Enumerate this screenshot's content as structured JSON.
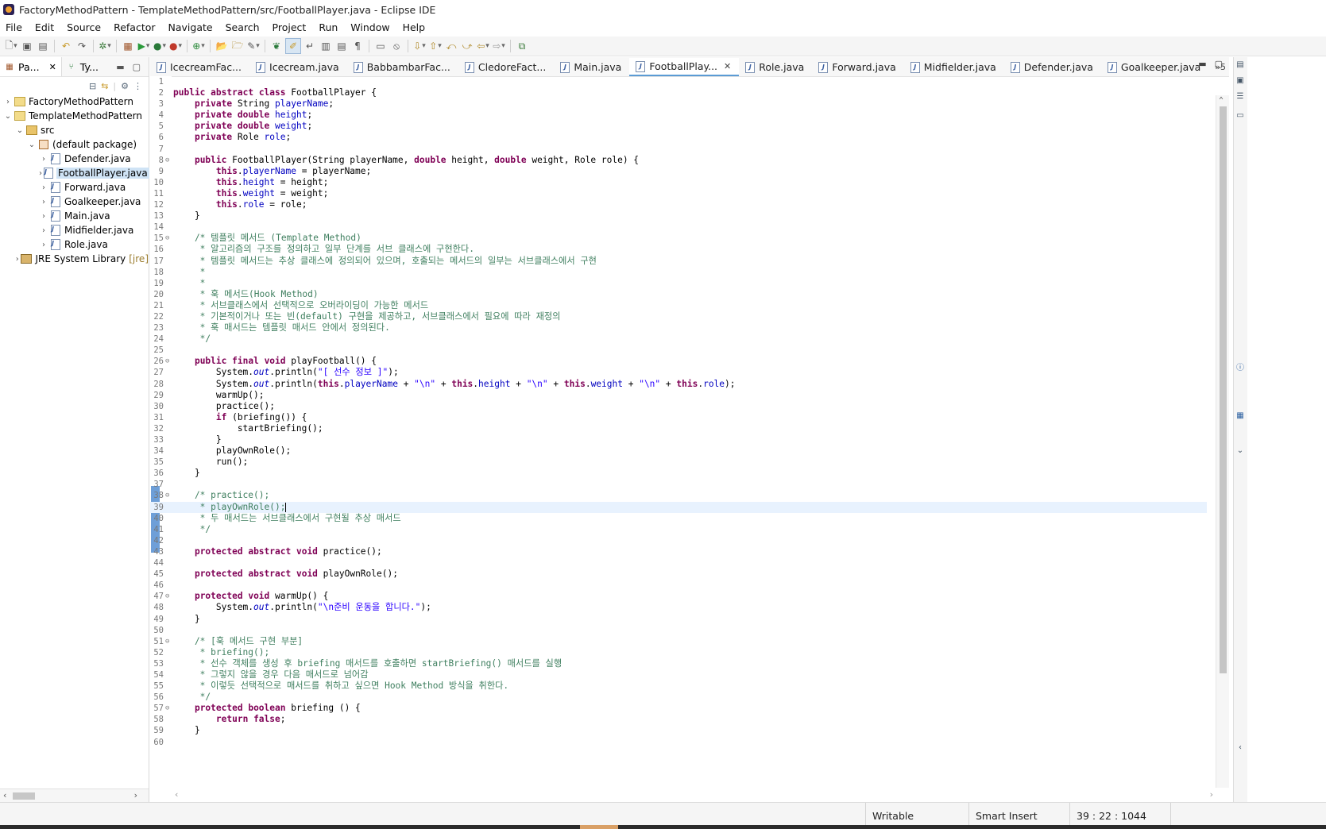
{
  "window": {
    "title": "FactoryMethodPattern - TemplateMethodPattern/src/FootballPlayer.java - Eclipse IDE"
  },
  "menu": [
    "File",
    "Edit",
    "Source",
    "Refactor",
    "Navigate",
    "Search",
    "Project",
    "Run",
    "Window",
    "Help"
  ],
  "left_view": {
    "tabs": [
      {
        "label": "Pa...",
        "icon": "package-explorer-icon"
      },
      {
        "label": "Ty...",
        "icon": "type-hierarchy-icon"
      }
    ],
    "tree": [
      {
        "label": "FactoryMethodPattern",
        "icon": "project",
        "depth": 0,
        "toggle": "collapsed"
      },
      {
        "label": "TemplateMethodPattern",
        "icon": "project",
        "depth": 0,
        "toggle": "expanded"
      },
      {
        "label": "src",
        "icon": "source-folder",
        "depth": 1,
        "toggle": "expanded"
      },
      {
        "label": "(default package)",
        "icon": "package",
        "depth": 2,
        "toggle": "expanded"
      },
      {
        "label": "Defender.java",
        "icon": "java-file",
        "depth": 3,
        "toggle": "collapsed"
      },
      {
        "label": "FootballPlayer.java",
        "icon": "java-file",
        "depth": 3,
        "toggle": "collapsed",
        "selected": true
      },
      {
        "label": "Forward.java",
        "icon": "java-file",
        "depth": 3,
        "toggle": "collapsed"
      },
      {
        "label": "Goalkeeper.java",
        "icon": "java-file",
        "depth": 3,
        "toggle": "collapsed"
      },
      {
        "label": "Main.java",
        "icon": "java-file",
        "depth": 3,
        "toggle": "collapsed"
      },
      {
        "label": "Midfielder.java",
        "icon": "java-file",
        "depth": 3,
        "toggle": "collapsed"
      },
      {
        "label": "Role.java",
        "icon": "java-file",
        "depth": 3,
        "toggle": "collapsed"
      },
      {
        "label": "JRE System Library",
        "tag": "[jre]",
        "icon": "library",
        "depth": 1,
        "toggle": "collapsed"
      }
    ]
  },
  "editor": {
    "tabs": [
      {
        "label": "IcecreamFac..."
      },
      {
        "label": "Icecream.java"
      },
      {
        "label": "BabbambarFac..."
      },
      {
        "label": "CledoreFact..."
      },
      {
        "label": "Main.java"
      },
      {
        "label": "FootballPlay...",
        "active": true
      },
      {
        "label": "Role.java"
      },
      {
        "label": "Forward.java"
      },
      {
        "label": "Midfielder.java"
      },
      {
        "label": "Defender.java"
      },
      {
        "label": "Goalkeeper.java"
      }
    ],
    "more_tabs": "»5",
    "current_line": 39,
    "lines": [
      "",
      "public abstract class FootballPlayer {",
      "    private String playerName;",
      "    private double height;",
      "    private double weight;",
      "    private Role role;",
      "",
      "    public FootballPlayer(String playerName, double height, double weight, Role role) {",
      "        this.playerName = playerName;",
      "        this.height = height;",
      "        this.weight = weight;",
      "        this.role = role;",
      "    }",
      "",
      "    /* 템플릿 메서드 (Template Method)",
      "     * 알고리즘의 구조를 정의하고 일부 단계를 서브 클래스에 구현한다.",
      "     * 템플릿 메서드는 추상 클래스에 정의되어 있으며, 호출되는 메서드의 일부는 서브클래스에서 구현",
      "     *",
      "     *",
      "     * 훅 메서드(Hook Method)",
      "     * 서브클래스에서 선택적으로 오버라이딩이 가능한 메서드",
      "     * 기본적이거나 또는 빈(default) 구현을 제공하고, 서브클래스에서 필요에 따라 재정의",
      "     * 훅 매서드는 템플릿 매서드 안에서 정의된다.",
      "     */",
      "",
      "    public final void playFootball() {",
      "        System.out.println(\"[ 선수 정보 ]\");",
      "        System.out.println(this.playerName + \"\\n\" + this.height + \"\\n\" + this.weight + \"\\n\" + this.role);",
      "        warmUp();",
      "        practice();",
      "        if (briefing()) {",
      "            startBriefing();",
      "        }",
      "        playOwnRole();",
      "        run();",
      "    }",
      "",
      "    /* practice();",
      "     * playOwnRole();",
      "     * 두 매서드는 서브클래스에서 구현될 추상 매서드",
      "     */",
      "",
      "    protected abstract void practice();",
      "",
      "    protected abstract void playOwnRole();",
      "",
      "    protected void warmUp() {",
      "        System.out.println(\"\\n준비 운동을 합니다.\");",
      "    }",
      "",
      "    /* [훅 메서드 구현 부분]",
      "     * briefing();",
      "     * 선수 객체를 생성 후 briefing 매서드를 호출하면 startBriefing() 매서드를 실행",
      "     * 그렇지 않을 경우 다음 매서드로 넘어감",
      "     * 이렇듯 선택적으로 매서드를 취하고 싶으면 Hook Method 방식을 취한다.",
      "     */",
      "    protected boolean briefing () {",
      "        return false;",
      "    }",
      ""
    ],
    "fold_lines": [
      8,
      15,
      26,
      38,
      47,
      51,
      57
    ]
  },
  "status": {
    "writable": "Writable",
    "insert_mode": "Smart Insert",
    "position": "39 : 22 : 1044"
  },
  "colors": {
    "keyword": "#7f0055",
    "field": "#0000c0",
    "string": "#2a00ff",
    "comment": "#3f7f5f",
    "current_line": "#e8f2fe",
    "selection": "#cfe3f5"
  }
}
